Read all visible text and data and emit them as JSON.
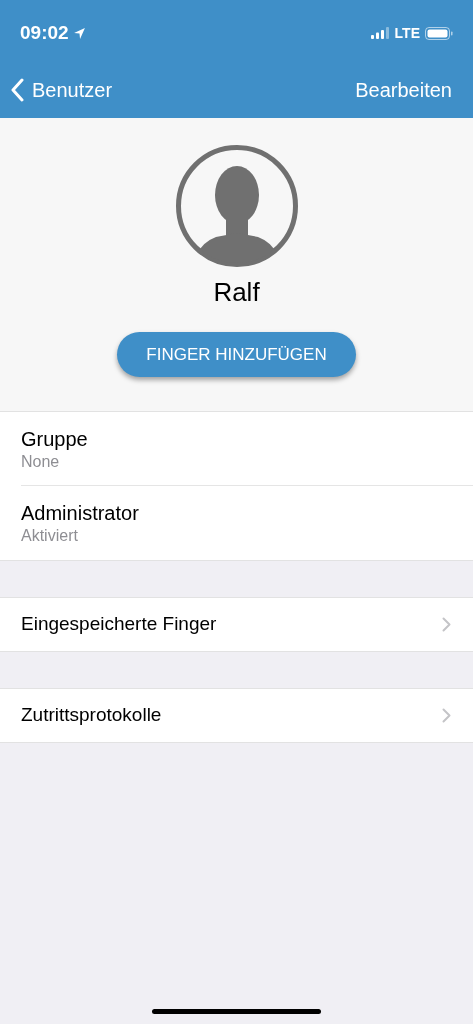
{
  "status_bar": {
    "time": "09:02",
    "network": "LTE"
  },
  "nav_bar": {
    "back": "Benutzer",
    "action": "Bearbeiten"
  },
  "profile": {
    "name": "Ralf",
    "button": "FINGER HINZUFÜGEN"
  },
  "details": [
    {
      "label": "Gruppe",
      "value": "None"
    },
    {
      "label": "Administrator",
      "value": "Aktiviert"
    }
  ],
  "links": [
    {
      "label": "Eingespeicherte Finger"
    },
    {
      "label": "Zutrittsprotokolle"
    }
  ]
}
